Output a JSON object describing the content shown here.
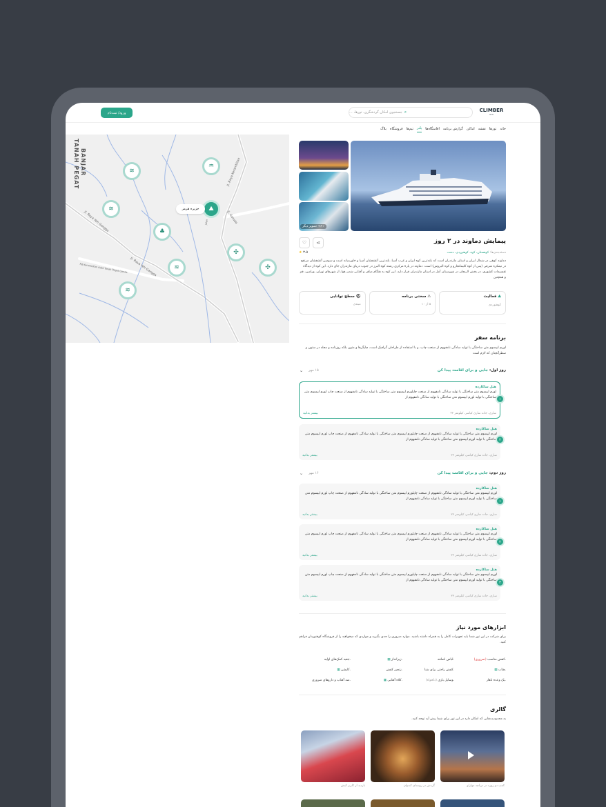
{
  "header": {
    "login_label": "ورود/ ثبت‌نام",
    "search_placeholder": "جستجوی امکان گردشگری، تورها، ...",
    "logo_text": "CLIMBER",
    "logo_sub": "G.G"
  },
  "nav": {
    "items": [
      "خانه",
      "تورها",
      "نقشه",
      "اماکن",
      "گزارش برنامه",
      "اقامتگاه‌ها",
      "پلنر",
      "تیم‌ها",
      "فروشگاه",
      "بلاگ"
    ],
    "active_index": 6
  },
  "map": {
    "selected_pin_label": "جزیره هرمز",
    "street_labels": [
      "BANJAR",
      "TANAH PEGAT",
      "Jl. Raya Kerambitan",
      "Jl. Raya Yeh Gangga",
      "Jl. Garuda",
      "Jl. Raya Yeh Gangga",
      "Rd Kerambitan Adat Tanah Pegat Ganda",
      "jalan"
    ]
  },
  "tour": {
    "title": "پیمایش دماوند در ۲ روز",
    "breadcrumb_prefix": "دسته‌بندی‌ها:",
    "breadcrumb": "کوهستان، کوه، کوهنوردی، دشت",
    "rating": "۳.۵",
    "more_photos": "۶+ تصویر دیگر",
    "description": "دماوند کوهی در شمال ایران و استان مازندران است که بلندترین کوه ایران و غرب آسیا، بلندترین آتشفشان آسیا و خاورمیانه است و سومین آتشفشان مرتفع در نیمکره شرقی (پس از کوه کلیمانجارو و کوه البروس) است. دماوند در پارهٔ مرکزی رشته کوه البرز در جنوب دریای مازندران جای دارد. این کوه از دیدگاه تقسیمات کشوری، در بخش لاریجان در شهرستان آمل در استان مازندران قرار دارد. این کوه به هنگام صاف و آفتابی شدن هوا، از شهرهای تهران، ورامین، قم و همچنین",
    "cards": [
      {
        "title": "فعالیت",
        "value": "کوهنوردی"
      },
      {
        "title": "سختی برنامه",
        "value": "۵ از ۱۰"
      },
      {
        "title": "سطح توانایی",
        "value": "مبتدی"
      }
    ]
  },
  "itinerary": {
    "title": "برنامه سفر",
    "description": "لورم ایپسوم متن ساختگی با تولید سادگی نامفهوم از صنعت چاپ، و با استفاده از طراحان گرافیک است، چاپگرها و متون بلکه روزنامه و مجله در ستون و سطرآنچنان که لازم است",
    "days": [
      {
        "label": "روز اول:",
        "subtitle": "جایی و برای اقامت پیدا کن",
        "date": "۱۵ مهر",
        "stops": [
          {
            "num": "۱",
            "name": "هتل ساکارده",
            "text": "لورم ایپسوم متن ساختگی با تولید سادگی نامفهوم از صنعت چاپلورم ایپسوم متن ساختگی با تولید سادگی نامفهوم از صنعت چاپ لورم ایپسوم متن ساختگی با تولید لورم ایپسوم متن ساختگی با تولید سادگی نامفهوم از",
            "address": "ساری، جاده ساری کیاسر، کیلومتر ۳۳",
            "more": "بیشتر بدانید"
          },
          {
            "num": "۲",
            "name": "هتل ساکارده",
            "text": "لورم ایپسوم متن ساختگی با تولید سادگی نامفهوم از صنعت چاپلورم ایپسوم متن ساختگی با تولید سادگی نامفهوم از صنعت چاپ لورم ایپسوم متن ساختگی با تولید لورم ایپسوم متن ساختگی با تولید سادگی نامفهوم از",
            "address": "ساری، جاده ساری کیاسر، کیلومتر ۳۳",
            "more": "بیشتر بدانید"
          }
        ]
      },
      {
        "label": "روز دوم:",
        "subtitle": "جایی و برای اقامت پیدا کن",
        "date": "۱۶ مهر",
        "stops": [
          {
            "num": "۱",
            "name": "هتل ساکارده",
            "text": "لورم ایپسوم متن ساختگی با تولید سادگی نامفهوم از صنعت چاپلورم ایپسوم متن ساختگی با تولید سادگی نامفهوم از صنعت چاپ لورم ایپسوم متن ساختگی با تولید لورم ایپسوم متن ساختگی با تولید سادگی نامفهوم از",
            "address": "ساری، جاده ساری کیاسر، کیلومتر ۳۳",
            "more": "بیشتر بدانید"
          },
          {
            "num": "۲",
            "name": "هتل ساکارده",
            "text": "لورم ایپسوم متن ساختگی با تولید سادگی نامفهوم از صنعت چاپلورم ایپسوم متن ساختگی با تولید سادگی نامفهوم از صنعت چاپ لورم ایپسوم متن ساختگی با تولید لورم ایپسوم متن ساختگی با تولید سادگی نامفهوم از",
            "address": "ساری، جاده ساری کیاسر، کیلومتر ۳۳",
            "more": "بیشتر بدانید"
          },
          {
            "num": "۳",
            "name": "هتل ساکارده",
            "text": "لورم ایپسوم متن ساختگی با تولید سادگی نامفهوم از صنعت چاپلورم ایپسوم متن ساختگی با تولید سادگی نامفهوم از صنعت چاپ لورم ایپسوم متن ساختگی با تولید لورم ایپسوم متن ساختگی با تولید سادگی نامفهوم از",
            "address": "ساری، جاده ساری کیاسر، کیلومتر ۳۳",
            "more": "بیشتر بدانید"
          }
        ]
      }
    ]
  },
  "tools": {
    "title": "ابزارهای مورد نیاز",
    "description": "برای شرکت در این تور شما باید تجهیزات کامل را به همراه داشته باشید. موارد ضروری را جدی بگیرید و مواردی که میخواهید را از فروشگاه کوهنوردان فراهم کنید.",
    "col1": [
      ".کفش مناسب",
      ".هتاب",
      ".یک وعده ناهار"
    ],
    "col1_tag": "(ضروری)",
    "col2": [
      ".لباس اضافه",
      ".کفش راحتی برای شنا",
      ".وسایل بازی"
    ],
    "col2_tag": "(دلخواه)",
    "col3": [
      ".زیرانداز",
      ".زنجیر کفش",
      ".کلاه آفتابی"
    ],
    "col4": [
      ".جعبه کمک‌های اولیه",
      ".کاپشن",
      ".ضد آفتاب و داروهای ضروری"
    ]
  },
  "gallery": {
    "title": "گالری",
    "description": "به محدودیت‌هایی که امکان دارد در این تور برای شما پیش آید توجه کنید.",
    "captions": [
      "کمپ دو روزه در دریاچه مهارلو",
      "گردش در روستای کندوان",
      "بازدید از کاریز کیش"
    ]
  },
  "colors": {
    "accent": "#2ba68a",
    "frame": "#383d45"
  }
}
